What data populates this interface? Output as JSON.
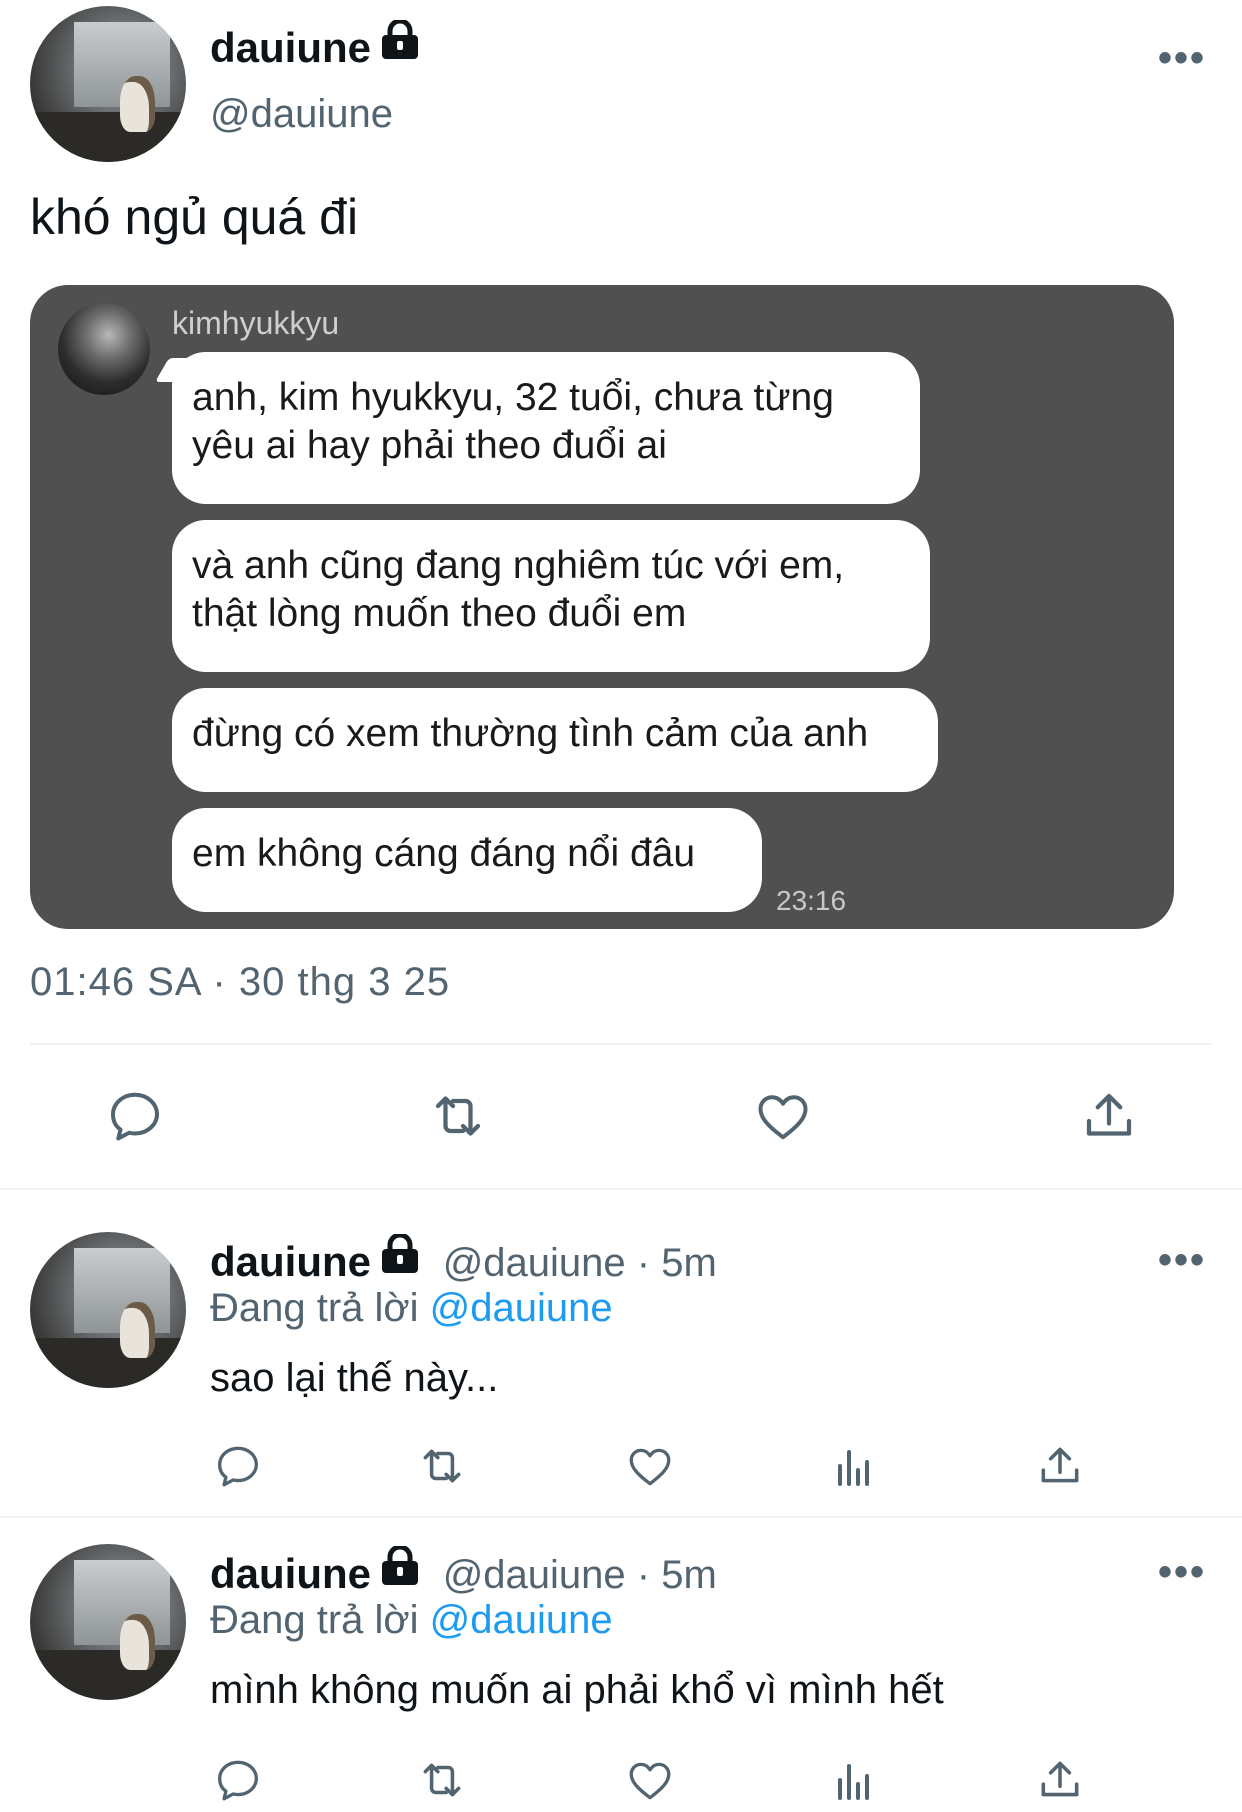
{
  "main_tweet": {
    "display_name": "dauiune",
    "handle": "@dauiune",
    "more_label": "•••",
    "text": "khó ngủ quá đi",
    "timestamp": "01:46 SA · 30 thg 3 25",
    "lock_icon": "lock-icon"
  },
  "chat_card": {
    "username": "kimhyukkyu",
    "messages": [
      [
        "anh, kim hyukkyu, 32 tuổi, chưa từng",
        "yêu ai hay phải theo đuổi ai"
      ],
      [
        "và anh cũng đang nghiêm túc với em,",
        "thật lòng muốn theo đuổi em"
      ],
      [
        "đừng có xem thường tình cảm của anh"
      ],
      [
        "em không cáng đáng nổi đâu"
      ]
    ],
    "time": "23:16",
    "colors": {
      "background": "#505050",
      "bubble": "#ffffff"
    }
  },
  "main_actions": [
    "reply-icon",
    "retweet-icon",
    "like-icon",
    "share-icon"
  ],
  "replies": [
    {
      "display_name": "dauiune",
      "handle_time": "@dauiune · 5m",
      "replying_prefix": "Đang trả lời",
      "replying_to": "@dauiune",
      "text": "sao lại thế này...",
      "more_label": "•••"
    },
    {
      "display_name": "dauiune",
      "handle_time": "@dauiune · 5m",
      "replying_prefix": "Đang trả lời",
      "replying_to": "@dauiune",
      "text": "mình không muốn ai phải khổ vì mình hết",
      "more_label": "•••"
    }
  ],
  "reply_actions": [
    "reply-icon",
    "retweet-icon",
    "like-icon",
    "analytics-icon",
    "share-icon"
  ],
  "colors": {
    "text": "#0f1419",
    "secondary": "#536471",
    "link": "#1d9bf0",
    "divider": "#eff3f4"
  }
}
